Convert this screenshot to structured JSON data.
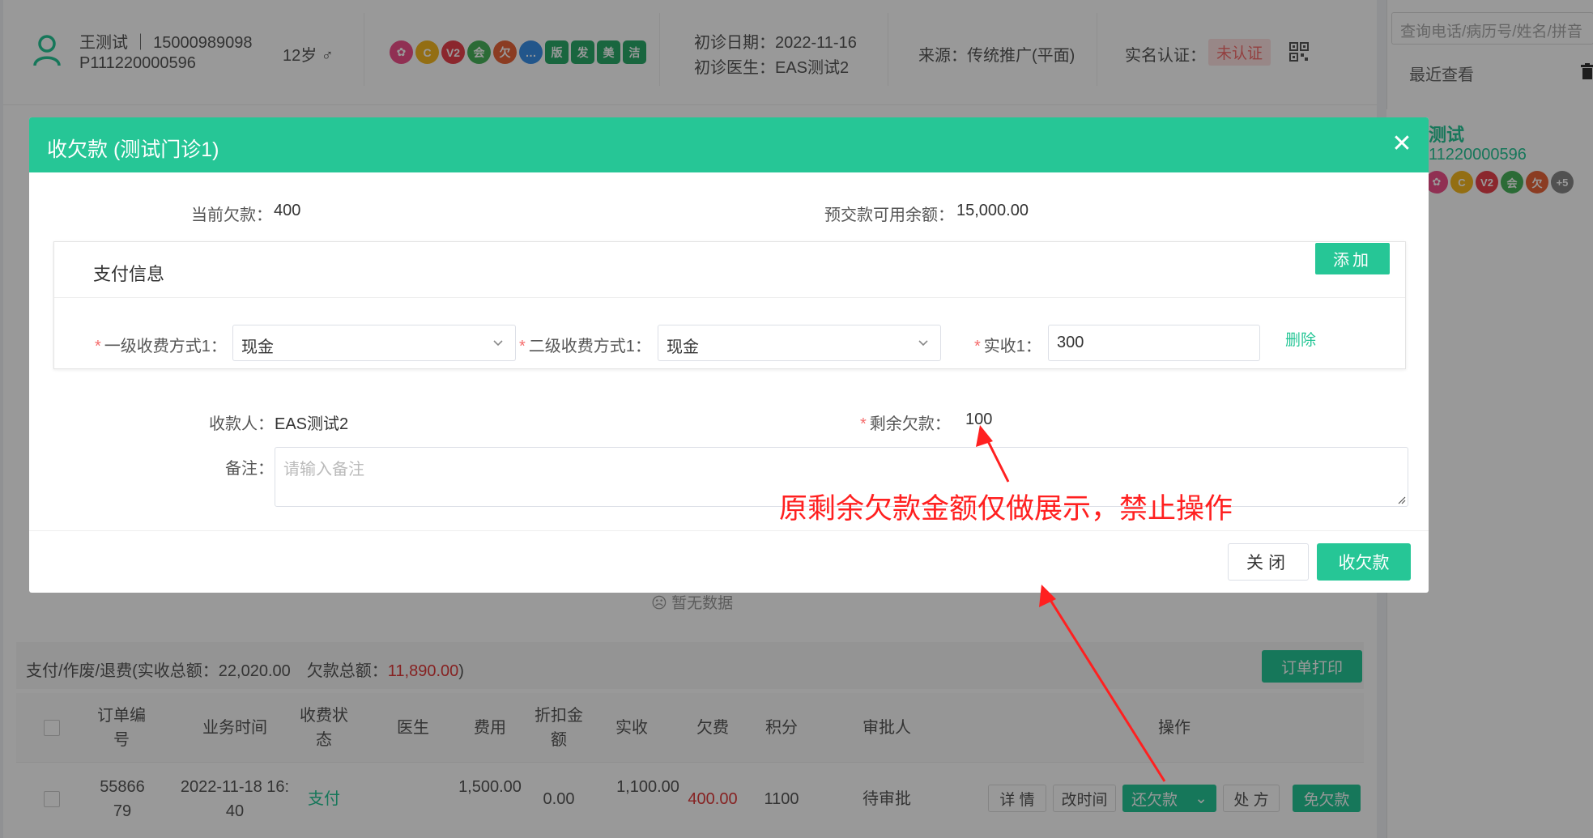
{
  "header": {
    "patient_name": "王测试 ｜ 15000989098",
    "patient_id": "P111220000596",
    "age": "12岁 ♂",
    "tags": [
      {
        "label": "✿",
        "color": "#f0508a",
        "shape": "circle"
      },
      {
        "label": "C",
        "color": "#f5b820",
        "shape": "circle"
      },
      {
        "label": "V2",
        "color": "#e8414b",
        "shape": "circle"
      },
      {
        "label": "会",
        "color": "#48b35a",
        "shape": "circle"
      },
      {
        "label": "欠",
        "color": "#e8643a",
        "shape": "circle"
      },
      {
        "label": "…",
        "color": "#3a8fe8",
        "shape": "circle"
      },
      {
        "label": "版",
        "color": "#2aaa6a",
        "shape": "sq"
      },
      {
        "label": "发",
        "color": "#2aaa6a",
        "shape": "sq"
      },
      {
        "label": "美",
        "color": "#2aaa6a",
        "shape": "sq"
      },
      {
        "label": "洁",
        "color": "#2aaa6a",
        "shape": "sq"
      }
    ],
    "first_visit_date": "初诊日期：2022-11-16",
    "first_visit_doctor": "初诊医生：EAS测试2",
    "source": "来源：传统推广(平面)",
    "realname_label": "实名认证：",
    "realname_status": "未认证"
  },
  "right_panel": {
    "search_placeholder": "查询电话/病历号/姓名/拼音",
    "recent_title": "最近查看",
    "recent_name": "测试",
    "recent_id": "11220000596",
    "recent_tags": [
      {
        "label": "✿",
        "color": "#f0508a"
      },
      {
        "label": "C",
        "color": "#f5b820"
      },
      {
        "label": "V2",
        "color": "#e8414b"
      },
      {
        "label": "会",
        "color": "#48b35a"
      },
      {
        "label": "欠",
        "color": "#e8643a"
      },
      {
        "label": "+5",
        "color": "#888888"
      }
    ]
  },
  "background": {
    "empty_text": "暂无数据",
    "summary_prefix": "支付/作废/退费(实收总额：22,020.00　欠款总额：",
    "summary_debt": "11,890.00",
    "summary_suffix": ")",
    "print_button": "订单打印",
    "table_headers": {
      "order_no": "订单编号",
      "time": "业务时间",
      "status": "收费状态",
      "doctor": "医生",
      "fee": "费用",
      "discount": "折扣金额",
      "received": "实收",
      "owed": "欠费",
      "points": "积分",
      "approver": "审批人",
      "ops": "操作"
    },
    "row": {
      "order_no": "5586679",
      "time": "2022-11-18 16:40",
      "status": "支付",
      "doctor": "",
      "fee": "1,500.00",
      "discount": "0.00",
      "received": "1,100.00",
      "owed": "400.00",
      "points": "1100",
      "approver": "待审批",
      "ops": {
        "detail": "详 情",
        "change_time": "改时间",
        "repay": "还欠款",
        "prescription": "处 方",
        "waive": "免欠款"
      }
    }
  },
  "modal": {
    "title": "收欠款 (测试门诊1)",
    "current_debt_label": "当前欠款：",
    "current_debt_value": "400",
    "prepaid_label": "预交款可用余额：",
    "prepaid_value": "15,000.00",
    "pay_info_title": "支付信息",
    "add_button": "添加",
    "method1_label": "一级收费方式1：",
    "method1_value": "现金",
    "method2_label": "二级收费方式1：",
    "method2_value": "现金",
    "received_label": "实收1：",
    "received_value": "300",
    "delete_link": "删除",
    "payee_label": "收款人：",
    "payee_value": "EAS测试2",
    "remaining_label": "剩余欠款：",
    "remaining_value": "100",
    "remark_label": "备注：",
    "remark_placeholder": "请输入备注",
    "close_button": "关闭",
    "collect_button": "收欠款"
  },
  "annotation": {
    "text": "原剩余欠款金额仅做展示，禁止操作",
    "color": "#ff2020"
  },
  "colors": {
    "accent": "#26c696",
    "danger": "#f56c6c"
  }
}
